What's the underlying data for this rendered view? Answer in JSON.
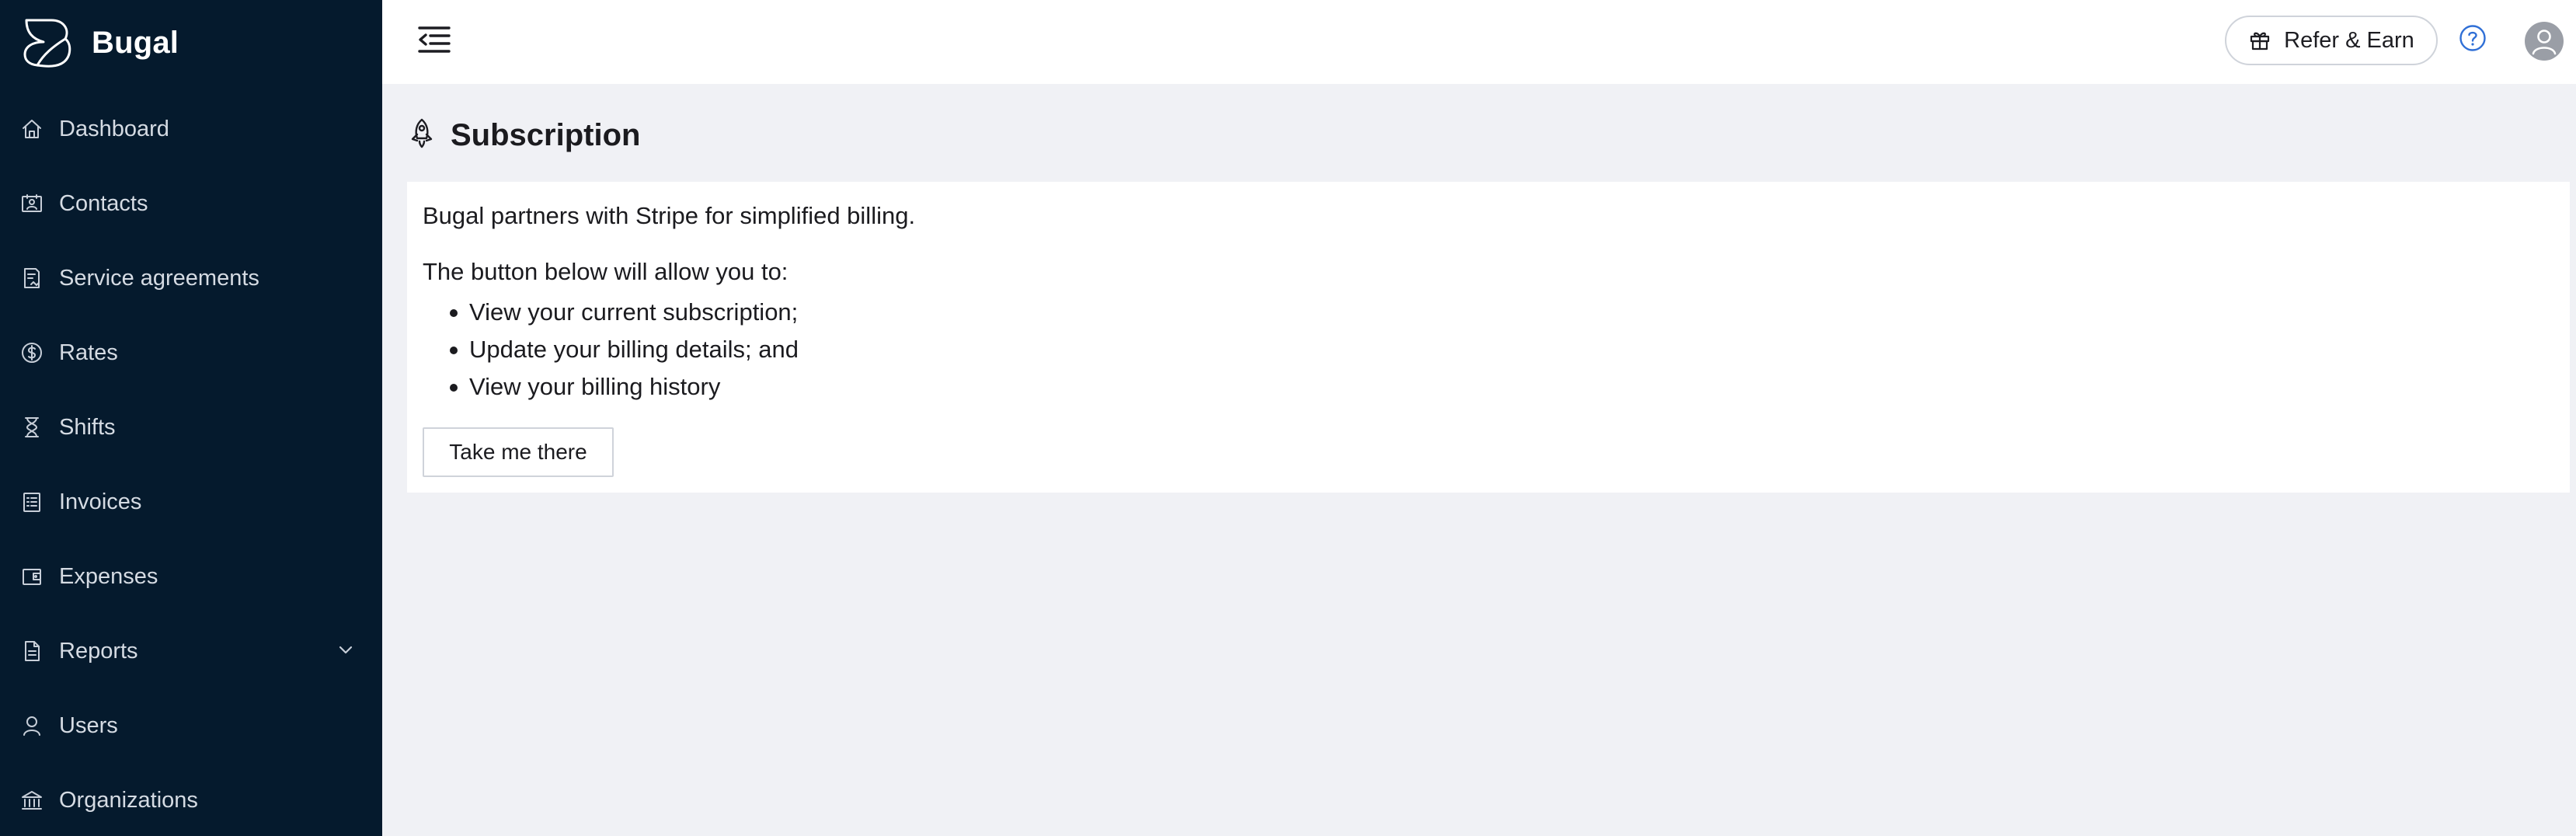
{
  "app": {
    "name": "Bugal"
  },
  "sidebar": {
    "items": [
      {
        "label": "Dashboard",
        "icon": "home-icon"
      },
      {
        "label": "Contacts",
        "icon": "contact-card-icon"
      },
      {
        "label": "Service agreements",
        "icon": "agreement-icon"
      },
      {
        "label": "Rates",
        "icon": "dollar-circle-icon"
      },
      {
        "label": "Shifts",
        "icon": "hourglass-icon"
      },
      {
        "label": "Invoices",
        "icon": "invoice-icon"
      },
      {
        "label": "Expenses",
        "icon": "wallet-icon"
      },
      {
        "label": "Reports",
        "icon": "report-icon"
      },
      {
        "label": "Users",
        "icon": "user-icon"
      },
      {
        "label": "Organizations",
        "icon": "bank-icon"
      }
    ]
  },
  "topbar": {
    "refer_label": "Refer & Earn",
    "icons": [
      "menu-collapse-icon",
      "gift-icon",
      "help-icon",
      "avatar-icon"
    ]
  },
  "page": {
    "title": "Subscription",
    "title_icon": "rocket-icon",
    "intro": "Bugal partners with Stripe for simplified billing.",
    "lead": "The button below will allow you to:",
    "bullets": [
      "View your current subscription;",
      "Update your billing details; and",
      "View your billing history"
    ],
    "button_label": "Take me there"
  },
  "colors": {
    "sidebar_bg": "#051a2d",
    "page_bg": "#f0f1f5",
    "help_accent": "#2f6fd6"
  }
}
